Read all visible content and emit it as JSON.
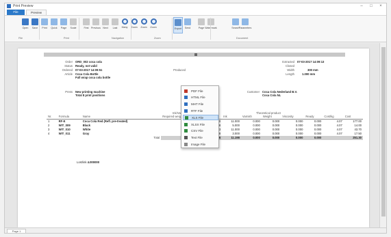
{
  "window": {
    "title": "Print Preview"
  },
  "tabs": [
    {
      "label": "File"
    },
    {
      "label": "Preview"
    }
  ],
  "ribbon": {
    "buttons": [
      {
        "label": "Open",
        "icon": "folder-icon",
        "style": "blue"
      },
      {
        "label": "Save",
        "icon": "save-icon",
        "style": "blue"
      },
      {
        "label": "Print",
        "icon": "print-icon",
        "style": "lblue"
      },
      {
        "label": "Quick Print",
        "icon": "quick-print-icon",
        "style": "lblue"
      },
      {
        "label": "Page Setup",
        "icon": "page-setup-icon",
        "style": "lblue"
      },
      {
        "label": "Scale",
        "icon": "scale-icon",
        "style": "grey"
      },
      {
        "label": "First Page",
        "icon": "first-page-icon",
        "style": "grey"
      },
      {
        "label": "Previous Page",
        "icon": "previous-page-icon",
        "style": "grey"
      },
      {
        "label": "Next Page",
        "icon": "next-page-icon",
        "style": "grey"
      },
      {
        "label": "Last Page",
        "icon": "last-page-icon",
        "style": "grey"
      },
      {
        "label": "Many Pages",
        "icon": "many-pages-icon",
        "style": "mag"
      },
      {
        "label": "Zoom Out",
        "icon": "zoom-out-icon",
        "style": "mag"
      },
      {
        "label": "Zoom",
        "icon": "zoom-icon",
        "style": "mag"
      },
      {
        "label": "Zoom In",
        "icon": "zoom-in-icon",
        "style": "mag"
      },
      {
        "label": "Export To",
        "icon": "export-icon",
        "style": "export"
      },
      {
        "label": "Send",
        "icon": "send-icon",
        "style": "lblue"
      },
      {
        "label": "Page Color",
        "icon": "page-color-icon",
        "style": "grey"
      },
      {
        "label": "Watermark",
        "icon": "watermark-icon",
        "style": "grey"
      },
      {
        "label": "Search",
        "icon": "search-icon",
        "style": "lblue"
      },
      {
        "label": "Parameters",
        "icon": "parameters-icon",
        "style": "lblue"
      }
    ],
    "groups": [
      {
        "label": "File"
      },
      {
        "label": "Print"
      },
      {
        "label": "Navigation"
      },
      {
        "label": "Zoom"
      },
      {
        "label": "Document"
      }
    ]
  },
  "export_menu": {
    "items": [
      {
        "label": "PDF File",
        "color": "#c0392b"
      },
      {
        "label": "HTML File",
        "color": "#2f6fbf"
      },
      {
        "label": "MHT File",
        "color": "#2f6fbf"
      },
      {
        "label": "RTF File",
        "color": "#2f6fbf"
      },
      {
        "label": "XLS File",
        "color": "#2e8b3e"
      },
      {
        "label": "XLSX File",
        "color": "#2e8b3e"
      },
      {
        "label": "CSV File",
        "color": "#2e8b3e"
      },
      {
        "label": "Text File",
        "color": "#555555"
      },
      {
        "label": "Image File",
        "color": "#888888"
      }
    ],
    "highlighted_index": 4
  },
  "document": {
    "order": {
      "label": "Order",
      "value": "ORD_002 coca cola"
    },
    "status": {
      "label": "Status",
      "value": "Ready, not valid"
    },
    "ordered": {
      "label": "Ordered",
      "value": "07-03-2017 14:09:51"
    },
    "produced": {
      "label": "Produced",
      "value": ""
    },
    "article": {
      "label": "Article",
      "value": "Coca Cola Bottle"
    },
    "article_desc": "Full wrap coca cola bottle",
    "extracted": {
      "label": "Extracted",
      "value": "07-03-2017 14:09:13"
    },
    "closed": {
      "label": "Closed",
      "value": ""
    },
    "width": {
      "label": "Width",
      "value": "300 mm"
    },
    "length": {
      "label": "Length",
      "value": "1.000 mm"
    },
    "press": {
      "label": "Press",
      "value": "New printing machine"
    },
    "press_desc": "Total 8 print positions",
    "customer": {
      "label": "Customer",
      "value": "Coca Cola Nederland B.V."
    },
    "customer_desc": "Coca Cola NL",
    "group_headers": [
      {
        "label": "Ink/Varnish/colour"
      },
      {
        "label": "Theoretical product"
      }
    ],
    "columns": [
      "Nr.",
      "Formula",
      "Name",
      "Required weight",
      "",
      "Ink",
      "Varnish",
      "Weight",
      "Viscosity",
      "Ready",
      "Cost/kg",
      "Cost"
    ],
    "rows": [
      [
        "1",
        "RF-E",
        "Coca Cola Red (Refl. pre-treated)",
        "40.000",
        "40.000",
        "11.000",
        "0.000",
        "0.000",
        "0.000",
        "0.000",
        "4.07",
        "177.00"
      ],
      [
        "2",
        "WIT_009",
        "Black",
        "8.000",
        "7.908",
        "5.000",
        "0.000",
        "0.000",
        "0.000",
        "0.000",
        "4.07",
        "14.00"
      ],
      [
        "3",
        "WIT_010",
        "White",
        "15.000",
        "15.013",
        "11.000",
        "0.000",
        "0.000",
        "0.000",
        "0.000",
        "4.07",
        "43.70"
      ],
      [
        "4",
        "WIT_011",
        "Gray",
        "2.000",
        "2.068",
        "3.000",
        "0.000",
        "0.000",
        "0.000",
        "0.000",
        "4.07",
        "17.50"
      ]
    ],
    "total": {
      "label": "Total",
      "values": [
        "100.000",
        "117.776",
        "11.198",
        "0.000",
        "0.000",
        "0.000",
        "0.000",
        "",
        "251.30"
      ]
    },
    "footer": {
      "label": "Lost/ink",
      "value": "4.000000"
    }
  },
  "status_bar": {
    "page_tab": "Page 1"
  }
}
